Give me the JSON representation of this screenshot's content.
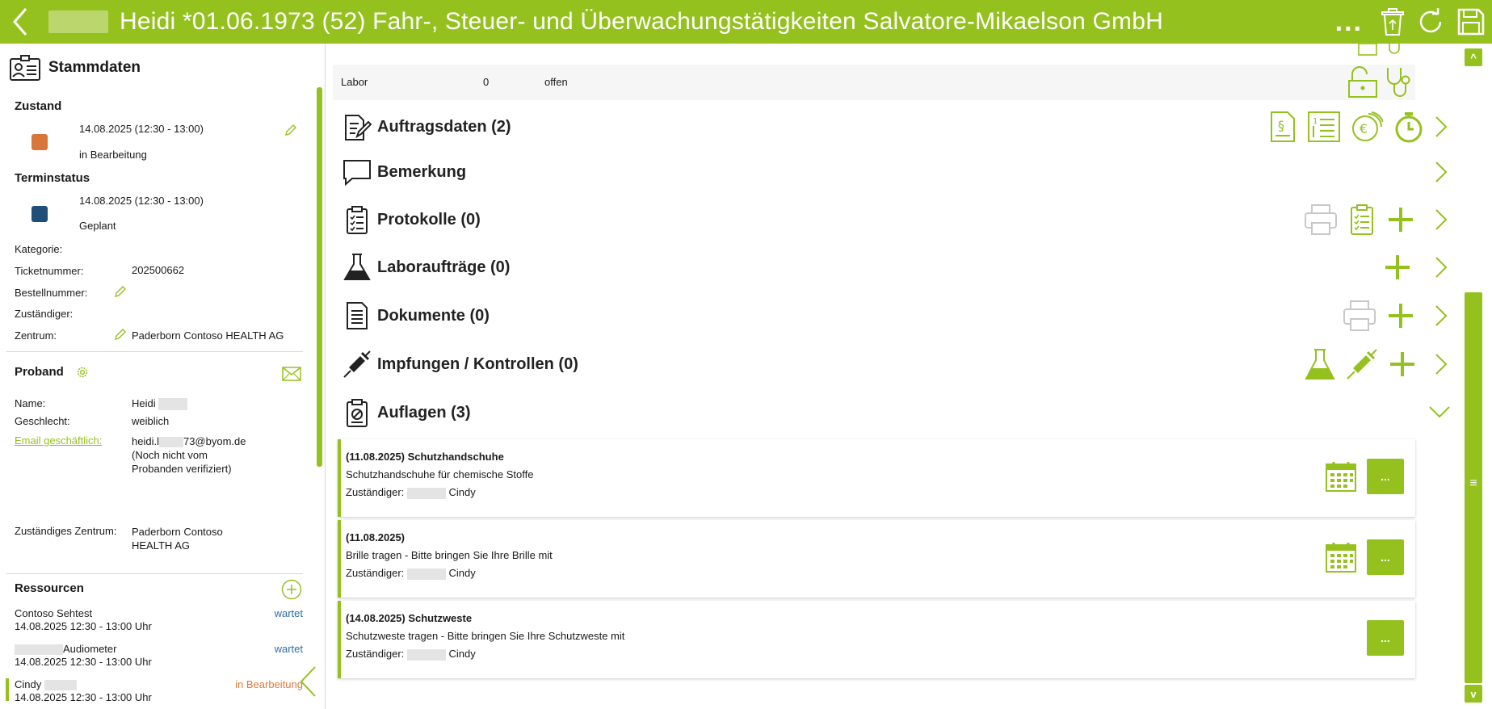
{
  "header": {
    "title": "Heidi *01.06.1973 (52) Fahr-, Steuer- und Überwachungstätigkeiten Salvatore-Mikaelson GmbH",
    "more_label": "...",
    "icons": [
      "back-arrow-icon",
      "recycle-bin-icon",
      "refresh-icon",
      "save-icon"
    ]
  },
  "stammdaten": {
    "title": "Stammdaten",
    "zustand": {
      "label": "Zustand",
      "date": "14.08.2025 (12:30 - 13:00)",
      "status": "in Bearbeitung",
      "color": "#d9773a"
    },
    "terminstatus": {
      "label": "Terminstatus",
      "date": "14.08.2025 (12:30 - 13:00)",
      "status": "Geplant",
      "color": "#1f4e79"
    },
    "fields": {
      "kategorie_label": "Kategorie:",
      "ticket_label": "Ticketnummer:",
      "ticket_value": "202500662",
      "bestell_label": "Bestellnummer:",
      "zustaendig_label": "Zuständiger:",
      "zentrum_label": "Zentrum:",
      "zentrum_value": "Paderborn Contoso HEALTH AG"
    }
  },
  "proband": {
    "title": "Proband",
    "name_label": "Name:",
    "name_value": "Heidi",
    "geschlecht_label": "Geschlecht:",
    "geschlecht_value": "weiblich",
    "email_label": "Email geschäftlich:",
    "email_value_a": "heidi.l",
    "email_value_b": "73@byom.de",
    "email_note_1": "(Noch nicht vom",
    "email_note_2": "Probanden verifiziert)",
    "zentrum_label": "Zuständiges Zentrum:",
    "zentrum_value_1": "Paderborn Contoso",
    "zentrum_value_2": "HEALTH AG"
  },
  "ressourcen": {
    "title": "Ressourcen",
    "items": [
      {
        "name": "Contoso Sehtest",
        "time": "14.08.2025 12:30 - 13:00 Uhr",
        "status": "wartet"
      },
      {
        "name": "Audiometer",
        "time": "14.08.2025 12:30 - 13:00 Uhr",
        "status": "wartet"
      },
      {
        "name": "Cindy",
        "time": "14.08.2025 12:30 - 13:00 Uhr",
        "status": "in Bearbeitung"
      }
    ]
  },
  "main": {
    "labor_row": {
      "label": "Labor",
      "count": "0",
      "status": "offen"
    },
    "sections": {
      "auftragsdaten": "Auftragsdaten (2)",
      "bemerkung": "Bemerkung",
      "protokolle": "Protokolle (0)",
      "laborauftraege": "Laboraufträge (0)",
      "dokumente": "Dokumente (0)",
      "impfungen": "Impfungen / Kontrollen (0)",
      "auflagen": "Auflagen (3)"
    },
    "auflagen": [
      {
        "title": "(11.08.2025) Schutzhandschuhe",
        "desc": "Schutzhandschuhe für chemische Stoffe",
        "resp_label": "Zuständiger:",
        "resp_name": "Cindy",
        "more": "..."
      },
      {
        "title": "(11.08.2025)",
        "desc": "Brille tragen - Bitte bringen Sie Ihre Brille mit",
        "resp_label": "Zuständiger:",
        "resp_name": "Cindy",
        "more": "..."
      },
      {
        "title": "(14.08.2025) Schutzweste",
        "desc": "Schutzweste tragen - Bitte bringen Sie Ihre Schutzweste mit",
        "resp_label": "Zuständiger:",
        "resp_name": "Cindy",
        "more": "..."
      }
    ]
  },
  "scroll": {
    "up": "^",
    "mid": "≡",
    "down": "v"
  },
  "colors": {
    "accent": "#95c11f",
    "wait": "#2e6da4",
    "processing": "#e07b39"
  }
}
